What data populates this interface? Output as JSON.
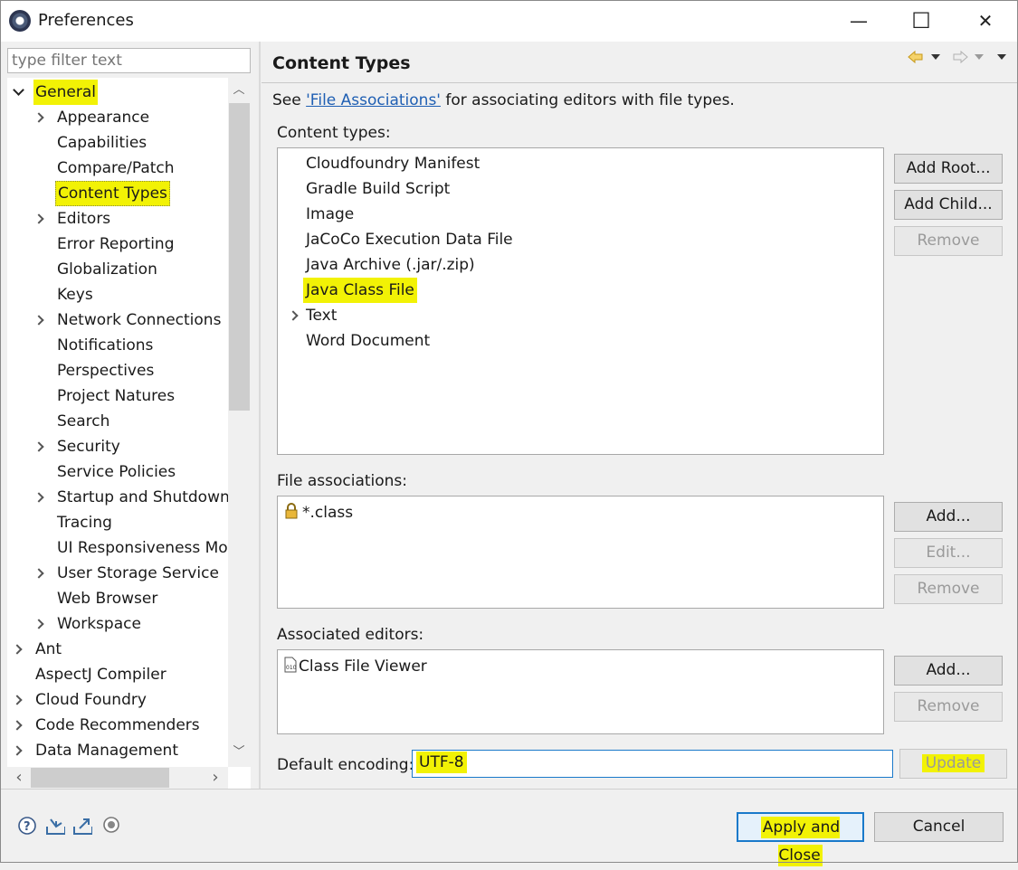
{
  "window": {
    "title": "Preferences",
    "minimize": "—",
    "maximize": "☐",
    "close": "✕"
  },
  "filter": {
    "placeholder": "type filter text"
  },
  "tree": {
    "items": [
      {
        "label": "General",
        "expander": "down",
        "level": 0,
        "highlighted": true
      },
      {
        "label": "Appearance",
        "expander": "right",
        "level": 1
      },
      {
        "label": "Capabilities",
        "expander": "none",
        "level": 1
      },
      {
        "label": "Compare/Patch",
        "expander": "none",
        "level": 1
      },
      {
        "label": "Content Types",
        "expander": "none",
        "level": 1,
        "highlighted": true,
        "selected": true
      },
      {
        "label": "Editors",
        "expander": "right",
        "level": 1
      },
      {
        "label": "Error Reporting",
        "expander": "none",
        "level": 1
      },
      {
        "label": "Globalization",
        "expander": "none",
        "level": 1
      },
      {
        "label": "Keys",
        "expander": "none",
        "level": 1
      },
      {
        "label": "Network Connections",
        "expander": "right",
        "level": 1
      },
      {
        "label": "Notifications",
        "expander": "none",
        "level": 1
      },
      {
        "label": "Perspectives",
        "expander": "none",
        "level": 1
      },
      {
        "label": "Project Natures",
        "expander": "none",
        "level": 1
      },
      {
        "label": "Search",
        "expander": "none",
        "level": 1
      },
      {
        "label": "Security",
        "expander": "right",
        "level": 1
      },
      {
        "label": "Service Policies",
        "expander": "none",
        "level": 1
      },
      {
        "label": "Startup and Shutdown",
        "expander": "right",
        "level": 1
      },
      {
        "label": "Tracing",
        "expander": "none",
        "level": 1
      },
      {
        "label": "UI Responsiveness Mor",
        "expander": "none",
        "level": 1
      },
      {
        "label": "User Storage Service",
        "expander": "right",
        "level": 1
      },
      {
        "label": "Web Browser",
        "expander": "none",
        "level": 1
      },
      {
        "label": "Workspace",
        "expander": "right",
        "level": 1
      },
      {
        "label": "Ant",
        "expander": "right",
        "level": 0
      },
      {
        "label": "AspectJ Compiler",
        "expander": "none",
        "level": 0
      },
      {
        "label": "Cloud Foundry",
        "expander": "right",
        "level": 0
      },
      {
        "label": "Code Recommenders",
        "expander": "right",
        "level": 0
      },
      {
        "label": "Data Management",
        "expander": "right",
        "level": 0
      }
    ]
  },
  "page": {
    "title": "Content Types",
    "description_prefix": "See ",
    "description_link": "'File Associations'",
    "description_suffix": " for associating editors with file types.",
    "content_types_label": "Content types:",
    "content_types": [
      {
        "label": "Cloudfoundry Manifest",
        "expander": "none"
      },
      {
        "label": "Gradle Build Script",
        "expander": "none"
      },
      {
        "label": "Image",
        "expander": "none"
      },
      {
        "label": "JaCoCo Execution Data File",
        "expander": "none"
      },
      {
        "label": "Java Archive (.jar/.zip)",
        "expander": "none"
      },
      {
        "label": "Java Class File",
        "expander": "none",
        "highlighted": true
      },
      {
        "label": "Text",
        "expander": "right"
      },
      {
        "label": "Word Document",
        "expander": "none"
      }
    ],
    "content_buttons": {
      "add_root": "Add Root...",
      "add_child": "Add Child...",
      "remove": "Remove"
    },
    "file_assoc_label": "File associations:",
    "file_assoc_items": [
      "*.class"
    ],
    "file_assoc_buttons": {
      "add": "Add...",
      "edit": "Edit...",
      "remove": "Remove"
    },
    "editors_label": "Associated editors:",
    "editors_items": [
      "Class File Viewer"
    ],
    "editors_buttons": {
      "add": "Add...",
      "remove": "Remove"
    },
    "encoding_label": "Default encoding:",
    "encoding_value": "UTF-8",
    "update_button": "Update"
  },
  "footer": {
    "apply_close": "Apply and Close",
    "cancel": "Cancel"
  },
  "colors": {
    "highlight": "#f2f205",
    "link": "#1f5fb3",
    "focus_border": "#1979ca"
  },
  "icons": [
    "help-icon",
    "import-icon",
    "export-icon",
    "record-icon",
    "back-arrow-icon",
    "forward-arrow-icon",
    "lock-icon",
    "class-file-icon"
  ]
}
